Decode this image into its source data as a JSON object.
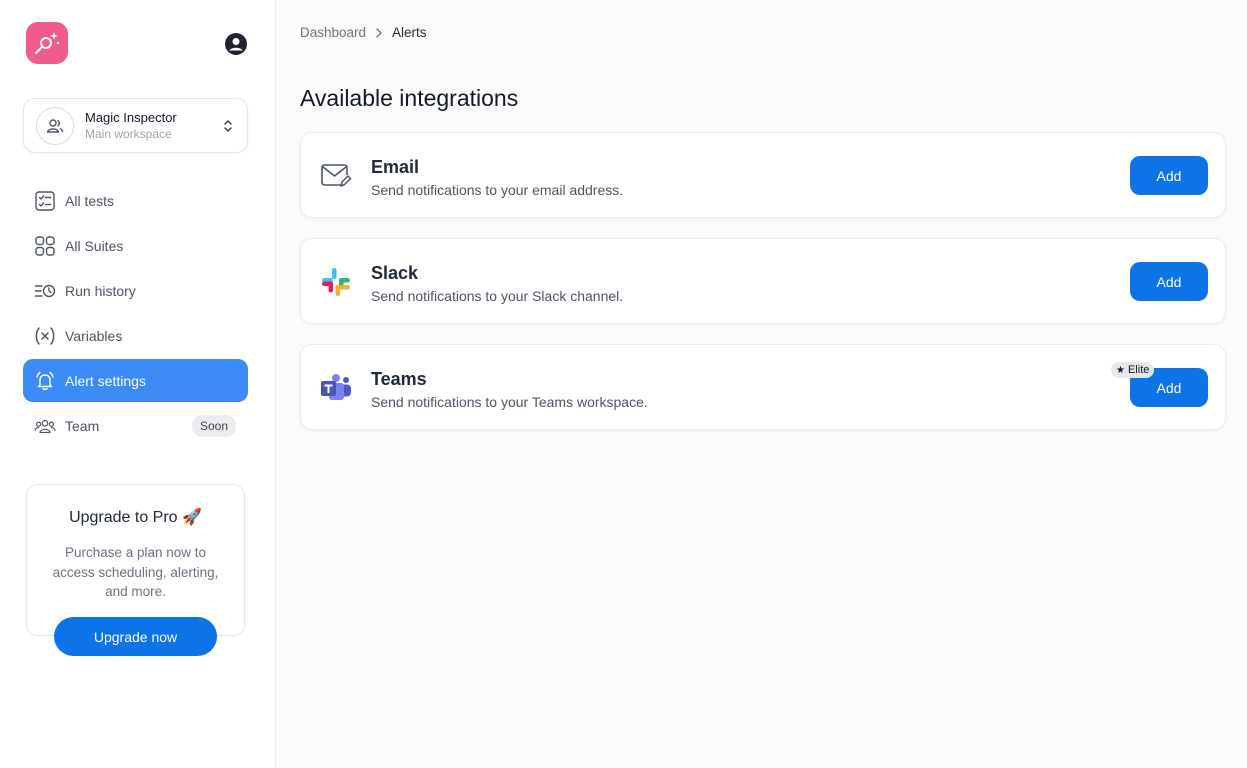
{
  "sidebar": {
    "workspace": {
      "name": "Magic Inspector",
      "subtitle": "Main workspace"
    },
    "nav": [
      {
        "label": "All tests",
        "icon": "checklist-icon"
      },
      {
        "label": "All Suites",
        "icon": "grid-icon"
      },
      {
        "label": "Run history",
        "icon": "history-icon"
      },
      {
        "label": "Variables",
        "icon": "variable-icon"
      },
      {
        "label": "Alert settings",
        "icon": "bell-icon",
        "active": true
      },
      {
        "label": "Team",
        "icon": "team-icon",
        "badge": "Soon"
      }
    ],
    "upgrade": {
      "title": "Upgrade to Pro 🚀",
      "description": "Purchase a plan now to access scheduling, alerting, and more.",
      "button": "Upgrade now"
    }
  },
  "breadcrumb": {
    "parent": "Dashboard",
    "current": "Alerts"
  },
  "page_title": "Available integrations",
  "integrations": [
    {
      "name": "Email",
      "description": "Send notifications to your email address.",
      "button": "Add",
      "icon": "email-icon"
    },
    {
      "name": "Slack",
      "description": "Send notifications to your Slack channel.",
      "button": "Add",
      "icon": "slack-icon"
    },
    {
      "name": "Teams",
      "description": "Send notifications to your Teams workspace.",
      "button": "Add",
      "icon": "teams-icon",
      "badge": "Elite"
    }
  ],
  "colors": {
    "primary": "#0d74e8",
    "active_nav": "#3b8af5",
    "logo": "#f05a8e"
  }
}
